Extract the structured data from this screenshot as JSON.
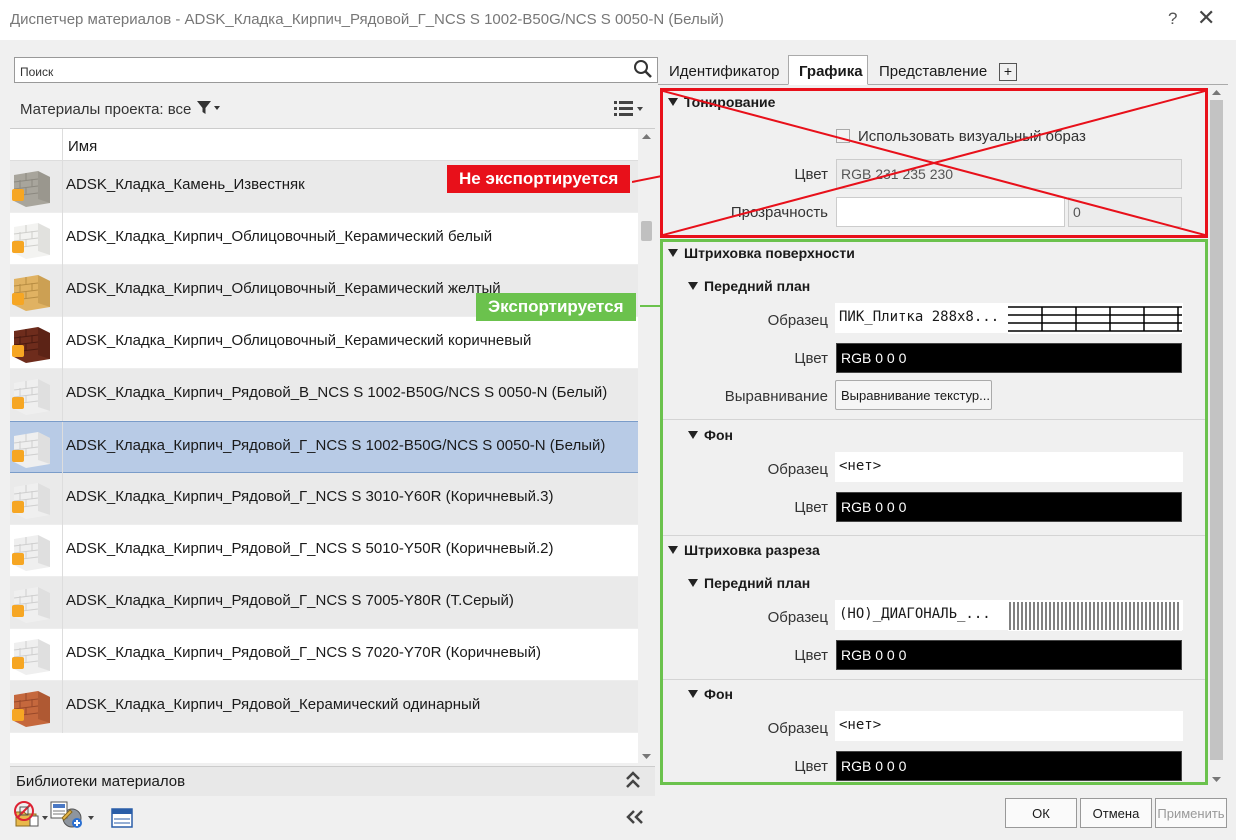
{
  "window": {
    "title": "Диспетчер материалов - ADSK_Кладка_Кирпич_Рядовой_Г_NCS S 1002-B50G/NCS S 0050-N (Белый)",
    "help": "?",
    "close": "✕"
  },
  "left": {
    "search_label": "Поиск",
    "project_materials_label": "Материалы проекта: все",
    "column_name": "Имя",
    "materials": [
      {
        "name": "ADSK_Кладка_Камень_Известняк",
        "color": "#a8a59c",
        "mortar": "#8c8980"
      },
      {
        "name": "ADSK_Кладка_Кирпич_Облицовочный_Керамический белый",
        "color": "#f3f3f1",
        "mortar": "#cfcfcc"
      },
      {
        "name": "ADSK_Кладка_Кирпич_Облицовочный_Керамический желтый",
        "color": "#e0b262",
        "mortar": "#b88d43"
      },
      {
        "name": "ADSK_Кладка_Кирпич_Облицовочный_Керамический коричневый",
        "color": "#6e2c1c",
        "mortar": "#4a1a10"
      },
      {
        "name": "ADSK_Кладка_Кирпич_Рядовой_В_NCS S 1002-B50G/NCS S 0050-N (Белый)",
        "color": "#efefef",
        "mortar": "#cfcfcf"
      },
      {
        "name": "ADSK_Кладка_Кирпич_Рядовой_Г_NCS S 1002-B50G/NCS S 0050-N (Белый)",
        "color": "#efefef",
        "mortar": "#cfcfcf"
      },
      {
        "name": "ADSK_Кладка_Кирпич_Рядовой_Г_NCS S 3010-Y60R (Коричневый.3)",
        "color": "#efefef",
        "mortar": "#cfcfcf"
      },
      {
        "name": "ADSK_Кладка_Кирпич_Рядовой_Г_NCS S 5010-Y50R (Коричневый.2)",
        "color": "#efefef",
        "mortar": "#cfcfcf"
      },
      {
        "name": "ADSK_Кладка_Кирпич_Рядовой_Г_NCS S 7005-Y80R (Т.Серый)",
        "color": "#efefef",
        "mortar": "#cfcfcf"
      },
      {
        "name": "ADSK_Кладка_Кирпич_Рядовой_Г_NCS S 7020-Y70R (Коричневый)",
        "color": "#efefef",
        "mortar": "#cfcfcf"
      },
      {
        "name": "ADSK_Кладка_Кирпич_Рядовой_Керамический одинарный",
        "color": "#c5683d",
        "mortar": "#99492a"
      }
    ],
    "selected_index": 5,
    "libraries_label": "Библиотеки материалов"
  },
  "tabs": [
    {
      "label": "Идентификатор"
    },
    {
      "label": "Графика"
    },
    {
      "label": "Представление"
    },
    {
      "label": "+"
    }
  ],
  "active_tab": "Графика",
  "shading": {
    "title": "Тонирование",
    "use_render_label": "Использовать визуальный образ",
    "color_label": "Цвет",
    "color_value": "RGB 231 235 230",
    "transparency_label": "Прозрачность",
    "transparency_value": "0"
  },
  "surface": {
    "title": "Штриховка поверхности",
    "foreground_title": "Передний план",
    "pattern_label": "Образец",
    "pattern_value": "ПИК_Плитка 288x8...",
    "color_label": "Цвет",
    "color_value": "RGB 0 0 0",
    "align_label": "Выравнивание",
    "align_button": "Выравнивание текстур...",
    "background_title": "Фон",
    "bg_pattern_label": "Образец",
    "bg_pattern_value": "<нет>",
    "bg_color_label": "Цвет",
    "bg_color_value": "RGB 0 0 0"
  },
  "cut": {
    "title": "Штриховка разреза",
    "foreground_title": "Передний план",
    "pattern_label": "Образец",
    "pattern_value": "(НО)_ДИАГОНАЛЬ_...",
    "color_label": "Цвет",
    "color_value": "RGB 0 0 0",
    "background_title": "Фон",
    "bg_pattern_label": "Образец",
    "bg_pattern_value": "<нет>",
    "bg_color_label": "Цвет",
    "bg_color_value": "RGB 0 0 0"
  },
  "annotations": {
    "not_exported": "Не экспортируется",
    "exported": "Экспортируется",
    "red": "#e8101a",
    "green": "#6bc24d"
  },
  "buttons": {
    "ok": "ОК",
    "cancel": "Отмена",
    "apply": "Применить"
  }
}
